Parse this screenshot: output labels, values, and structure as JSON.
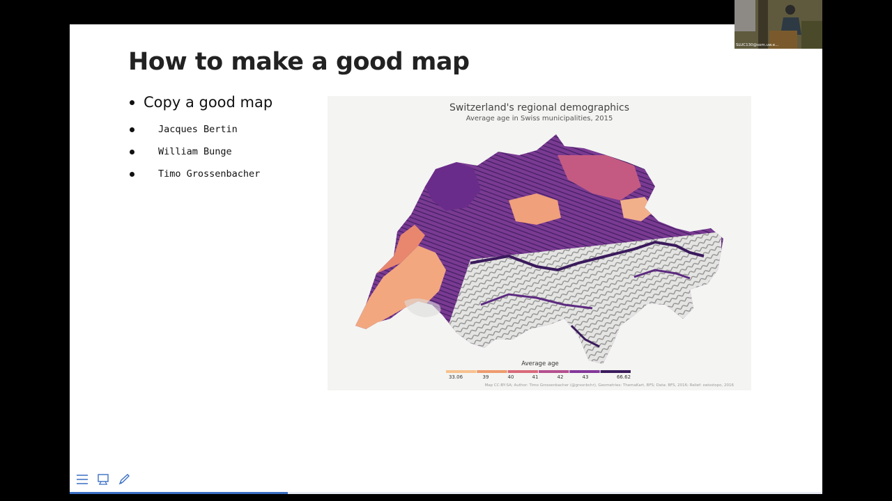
{
  "slide": {
    "title": "How to make a good map",
    "bullet": "Copy a good map",
    "sub_bullets": [
      "Jacques Bertin",
      "William Bunge",
      "Timo Grossenbacher"
    ]
  },
  "map": {
    "title": "Switzerland's regional demographics",
    "subtitle": "Average age in Swiss municipalities, 2015",
    "legend_title": "Average age",
    "legend_labels": [
      "33.06",
      "39",
      "40",
      "41",
      "42",
      "43",
      "66.62"
    ],
    "legend_colors": [
      "#f7c28f",
      "#ee9a6e",
      "#d96a7a",
      "#b5508f",
      "#84379a",
      "#3a1a5c"
    ],
    "credit": "Map CC-BY-SA; Author: Timo Grossenbacher (@grssnbchr), Geometries: ThemaKart, BFS; Data: BFS, 2016; Relief: swisstopo, 2016"
  },
  "webcam": {
    "label": "SLUC130@som.uw.e..."
  },
  "toolbar": {
    "icons": [
      "menu-icon",
      "slides-icon",
      "pen-icon"
    ]
  },
  "progress": {
    "fraction": 0.29
  }
}
